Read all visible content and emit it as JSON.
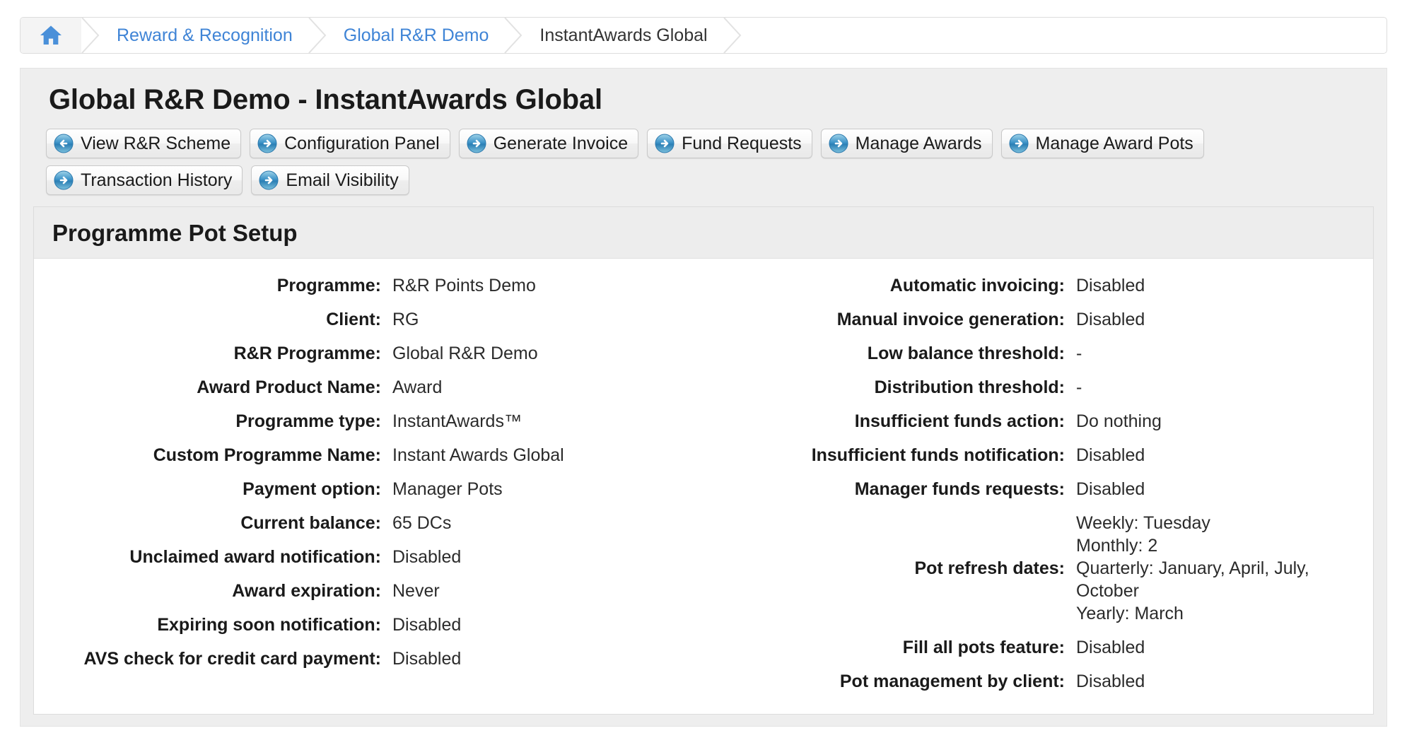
{
  "breadcrumb": {
    "home_icon": "home-icon",
    "items": [
      {
        "label": "Reward & Recognition",
        "type": "link"
      },
      {
        "label": "Global R&R Demo",
        "type": "link"
      },
      {
        "label": "InstantAwards Global",
        "type": "current"
      }
    ]
  },
  "page": {
    "title": "Global R&R Demo - InstantAwards Global"
  },
  "toolbar": {
    "buttons": [
      {
        "label": "View R&R Scheme",
        "icon": "arrow-left-circle-icon",
        "direction": "left"
      },
      {
        "label": "Configuration Panel",
        "icon": "arrow-right-circle-icon",
        "direction": "right"
      },
      {
        "label": "Generate Invoice",
        "icon": "arrow-right-circle-icon",
        "direction": "right"
      },
      {
        "label": "Fund Requests",
        "icon": "arrow-right-circle-icon",
        "direction": "right"
      },
      {
        "label": "Manage Awards",
        "icon": "arrow-right-circle-icon",
        "direction": "right"
      },
      {
        "label": "Manage Award Pots",
        "icon": "arrow-right-circle-icon",
        "direction": "right"
      },
      {
        "label": "Transaction History",
        "icon": "arrow-right-circle-icon",
        "direction": "right"
      },
      {
        "label": "Email Visibility",
        "icon": "arrow-right-circle-icon",
        "direction": "right"
      }
    ]
  },
  "card": {
    "heading": "Programme Pot Setup",
    "left_column": [
      {
        "label": "Programme:",
        "value": "R&R Points Demo"
      },
      {
        "label": "Client:",
        "value": "RG"
      },
      {
        "label": "R&R Programme:",
        "value": "Global R&R Demo"
      },
      {
        "label": "Award Product Name:",
        "value": "Award"
      },
      {
        "label": "Programme type:",
        "value": "InstantAwards™"
      },
      {
        "label": "Custom Programme Name:",
        "value": "Instant Awards Global"
      },
      {
        "label": "Payment option:",
        "value": "Manager Pots"
      },
      {
        "label": "Current balance:",
        "value": "65 DCs"
      },
      {
        "label": "Unclaimed award notification:",
        "value": "Disabled"
      },
      {
        "label": "Award expiration:",
        "value": "Never"
      },
      {
        "label": "Expiring soon notification:",
        "value": "Disabled"
      },
      {
        "label": "AVS check for credit card payment:",
        "value": "Disabled"
      }
    ],
    "right_column": [
      {
        "label": "Automatic invoicing:",
        "value": "Disabled"
      },
      {
        "label": "Manual invoice generation:",
        "value": "Disabled"
      },
      {
        "label": "Low balance threshold:",
        "value": "-"
      },
      {
        "label": "Distribution threshold:",
        "value": "-"
      },
      {
        "label": "Insufficient funds action:",
        "value": "Do nothing"
      },
      {
        "label": "Insufficient funds notification:",
        "value": "Disabled"
      },
      {
        "label": "Manager funds requests:",
        "value": "Disabled"
      },
      {
        "label": "Pot refresh dates:",
        "value": "Weekly: Tuesday\nMonthly: 2\nQuarterly: January, April, July,\nOctober\nYearly: March"
      },
      {
        "label": "Fill all pots feature:",
        "value": "Disabled"
      },
      {
        "label": "Pot management by client:",
        "value": "Disabled"
      }
    ]
  },
  "colors": {
    "link": "#3f84d6",
    "icon_blue": "#4a90d9",
    "panel_bg": "#eeeeee",
    "card_header_bg": "#ededed"
  }
}
